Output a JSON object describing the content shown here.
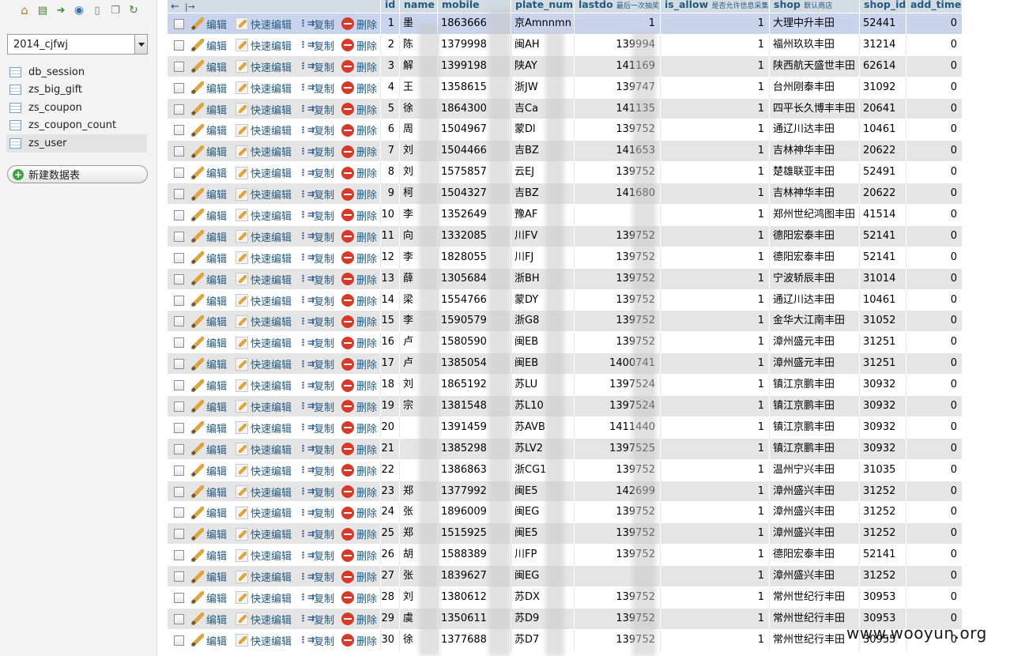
{
  "nav": {
    "icons": [
      "home-icon",
      "database-icon",
      "exit-icon",
      "query-icon",
      "docs-icon",
      "copy-icon",
      "reload-icon"
    ],
    "database_select": "2014_cjfwj",
    "tables": [
      "db_session",
      "zs_big_gift",
      "zs_coupon",
      "zs_coupon_count",
      "zs_user"
    ],
    "active_table": "zs_user",
    "new_table_label": "新建数据表"
  },
  "grid": {
    "arrows": "←   |→",
    "columns": {
      "id": "id",
      "name": "name",
      "mobile": "mobile",
      "plate_num": "plate_num",
      "lastdo": "lastdo",
      "lastdo_note": "最后一次抽奖",
      "is_allow": "is_allow",
      "is_allow_note": "是否允许信息采集",
      "shop": "shop",
      "shop_note": "默认商店",
      "shop_id": "shop_id",
      "add_time": "add_time"
    },
    "actions": {
      "edit": "编辑",
      "quick_edit": "快速编辑",
      "copy": "复制",
      "delete": "删除"
    },
    "rows": [
      {
        "id": "1",
        "name": "墨",
        "mobile": "1863666",
        "plate": "京Amnnmn",
        "lastdo": "1",
        "allow": "1",
        "shop": "大理中升丰田",
        "shop_id": "52441",
        "add_time": "0"
      },
      {
        "id": "2",
        "name": "陈",
        "mobile": "1379998",
        "plate": "闽AH",
        "lastdo": "139994",
        "allow": "1",
        "shop": "福州玖玖丰田",
        "shop_id": "31214",
        "add_time": "0"
      },
      {
        "id": "3",
        "name": "解",
        "mobile": "1399198",
        "plate": "陕AY",
        "lastdo": "141169",
        "allow": "1",
        "shop": "陕西航天盛世丰田",
        "shop_id": "62614",
        "add_time": "0"
      },
      {
        "id": "4",
        "name": "王",
        "mobile": "1358615",
        "plate": "浙JW",
        "lastdo": "139747",
        "allow": "1",
        "shop": "台州刚泰丰田",
        "shop_id": "31092",
        "add_time": "0"
      },
      {
        "id": "5",
        "name": "徐",
        "mobile": "1864300",
        "plate": "吉Ca",
        "lastdo": "141135",
        "allow": "1",
        "shop": "四平长久博丰丰田",
        "shop_id": "20641",
        "add_time": "0"
      },
      {
        "id": "6",
        "name": "周",
        "mobile": "1504967",
        "plate": "蒙Dl",
        "lastdo": "139752",
        "allow": "1",
        "shop": "通辽川达丰田",
        "shop_id": "10461",
        "add_time": "0"
      },
      {
        "id": "7",
        "name": "刘",
        "mobile": "1504466",
        "plate": "吉BZ",
        "lastdo": "141653",
        "allow": "1",
        "shop": "吉林神华丰田",
        "shop_id": "20622",
        "add_time": "0"
      },
      {
        "id": "8",
        "name": "刘",
        "mobile": "1575857",
        "plate": "云EJ",
        "lastdo": "139752",
        "allow": "1",
        "shop": "楚雄联亚丰田",
        "shop_id": "52491",
        "add_time": "0"
      },
      {
        "id": "9",
        "name": "柯",
        "mobile": "1504327",
        "plate": "吉BZ",
        "lastdo": "141680",
        "allow": "1",
        "shop": "吉林神华丰田",
        "shop_id": "20622",
        "add_time": "0"
      },
      {
        "id": "10",
        "name": "李",
        "mobile": "1352649",
        "plate": "豫AF",
        "lastdo": "",
        "allow": "1",
        "shop": "郑州世纪鸿图丰田",
        "shop_id": "41514",
        "add_time": "0"
      },
      {
        "id": "11",
        "name": "向",
        "mobile": "1332085",
        "plate": "川FV",
        "lastdo": "139752",
        "allow": "1",
        "shop": "德阳宏泰丰田",
        "shop_id": "52141",
        "add_time": "0"
      },
      {
        "id": "12",
        "name": "李",
        "mobile": "1828055",
        "plate": "川FJ",
        "lastdo": "139752",
        "allow": "1",
        "shop": "德阳宏泰丰田",
        "shop_id": "52141",
        "add_time": "0"
      },
      {
        "id": "13",
        "name": "薛",
        "mobile": "1305684",
        "plate": "浙BH",
        "lastdo": "139752",
        "allow": "1",
        "shop": "宁波轿辰丰田",
        "shop_id": "31014",
        "add_time": "0"
      },
      {
        "id": "14",
        "name": "梁",
        "mobile": "1554766",
        "plate": "蒙DY",
        "lastdo": "139752",
        "allow": "1",
        "shop": "通辽川达丰田",
        "shop_id": "10461",
        "add_time": "0"
      },
      {
        "id": "15",
        "name": "李",
        "mobile": "1590579",
        "plate": "浙G8",
        "lastdo": "139752",
        "allow": "1",
        "shop": "金华大江南丰田",
        "shop_id": "31052",
        "add_time": "0"
      },
      {
        "id": "16",
        "name": "卢",
        "mobile": "1580590",
        "plate": "闽EB",
        "lastdo": "139752",
        "allow": "1",
        "shop": "漳州盛元丰田",
        "shop_id": "31251",
        "add_time": "0"
      },
      {
        "id": "17",
        "name": "卢",
        "mobile": "1385054",
        "plate": "闽EB",
        "lastdo": "1400741",
        "allow": "1",
        "shop": "漳州盛元丰田",
        "shop_id": "31251",
        "add_time": "0"
      },
      {
        "id": "18",
        "name": "刘",
        "mobile": "1865192",
        "plate": "苏LU",
        "lastdo": "1397524",
        "allow": "1",
        "shop": "镇江京鹏丰田",
        "shop_id": "30932",
        "add_time": "0"
      },
      {
        "id": "19",
        "name": "宗",
        "mobile": "1381548",
        "plate": "苏L10",
        "lastdo": "1397524",
        "allow": "1",
        "shop": "镇江京鹏丰田",
        "shop_id": "30932",
        "add_time": "0"
      },
      {
        "id": "20",
        "name": "",
        "mobile": "1391459",
        "plate": "苏AVB",
        "lastdo": "1411440",
        "allow": "1",
        "shop": "镇江京鹏丰田",
        "shop_id": "30932",
        "add_time": "0"
      },
      {
        "id": "21",
        "name": "",
        "mobile": "1385298",
        "plate": "苏LV2",
        "lastdo": "1397525",
        "allow": "1",
        "shop": "镇江京鹏丰田",
        "shop_id": "30932",
        "add_time": "0"
      },
      {
        "id": "22",
        "name": "",
        "mobile": "1386863",
        "plate": "浙CG1",
        "lastdo": "139752",
        "allow": "1",
        "shop": "温州宁兴丰田",
        "shop_id": "31035",
        "add_time": "0"
      },
      {
        "id": "23",
        "name": "郑",
        "mobile": "1377992",
        "plate": "闽E5",
        "lastdo": "142699",
        "allow": "1",
        "shop": "漳州盛兴丰田",
        "shop_id": "31252",
        "add_time": "0"
      },
      {
        "id": "24",
        "name": "张",
        "mobile": "1896009",
        "plate": "闽EG",
        "lastdo": "139752",
        "allow": "1",
        "shop": "漳州盛兴丰田",
        "shop_id": "31252",
        "add_time": "0"
      },
      {
        "id": "25",
        "name": "郑",
        "mobile": "1515925",
        "plate": "闽E5",
        "lastdo": "139752",
        "allow": "1",
        "shop": "漳州盛兴丰田",
        "shop_id": "31252",
        "add_time": "0"
      },
      {
        "id": "26",
        "name": "胡",
        "mobile": "1588389",
        "plate": "川FP",
        "lastdo": "139752",
        "allow": "1",
        "shop": "德阳宏泰丰田",
        "shop_id": "52141",
        "add_time": "0"
      },
      {
        "id": "27",
        "name": "张",
        "mobile": "1839627",
        "plate": "闽EG",
        "lastdo": "",
        "allow": "1",
        "shop": "漳州盛兴丰田",
        "shop_id": "31252",
        "add_time": "0"
      },
      {
        "id": "28",
        "name": "刘",
        "mobile": "1380612",
        "plate": "苏DX",
        "lastdo": "139752",
        "allow": "1",
        "shop": "常州世纪行丰田",
        "shop_id": "30953",
        "add_time": "0"
      },
      {
        "id": "29",
        "name": "虞",
        "mobile": "1350611",
        "plate": "苏D9",
        "lastdo": "139752",
        "allow": "1",
        "shop": "常州世纪行丰田",
        "shop_id": "30953",
        "add_time": "0"
      },
      {
        "id": "30",
        "name": "徐",
        "mobile": "1377688",
        "plate": "苏D7",
        "lastdo": "139752",
        "allow": "1",
        "shop": "常州世纪行丰田",
        "shop_id": "30955",
        "add_time": "0"
      }
    ]
  },
  "watermark": "www.wooyun.org",
  "colors": {
    "header_bg": "#d3dce3",
    "row_odd": "#e5e5e5",
    "row_selected": "#c9d3ec",
    "link": "#235a81"
  }
}
